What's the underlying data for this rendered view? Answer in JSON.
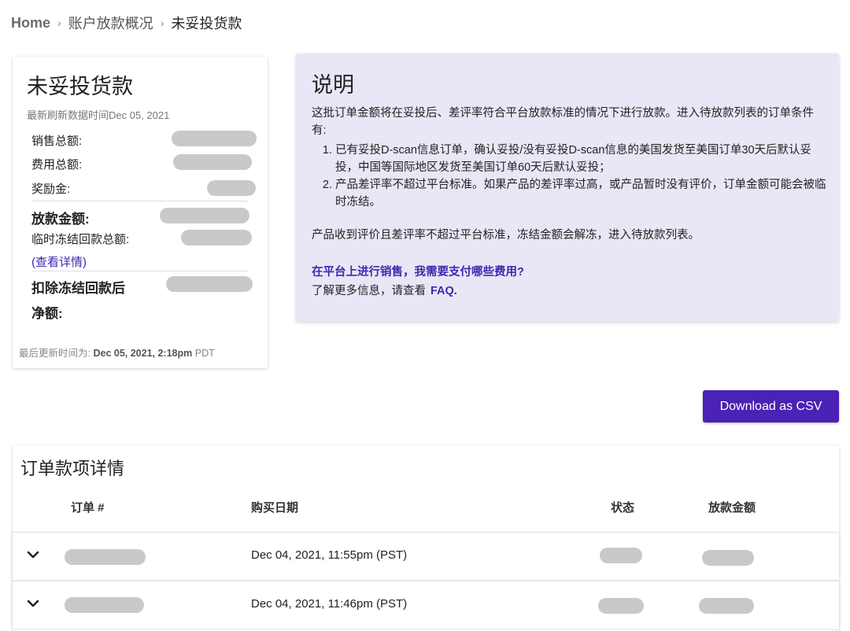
{
  "breadcrumb": {
    "home": "Home",
    "middle": "账户放款概况",
    "current": "未妥投货款",
    "separator": "›"
  },
  "summary": {
    "title": "未妥投货款",
    "refresh": "最新刷新数据时间Dec 05, 2021",
    "rows": {
      "sales": "销售总额:",
      "fees": "费用总额:",
      "bonus": "奖励金:",
      "payout": "放款金额:",
      "frozen": "临时冻结回款总额:",
      "details_link": "(查看详情)",
      "net_line1": "扣除冻结回款后",
      "net_line2": "净额:"
    },
    "footer": {
      "prefix": "最后更新时间为:",
      "time": "Dec 05, 2021, 2:18pm",
      "tz": "PDT"
    }
  },
  "info": {
    "title": "说明",
    "intro": "这批订单金额将在妥投后、差评率符合平台放款标准的情况下进行放款。进入待放款列表的订单条件有:",
    "items": [
      "已有妥投D-scan信息订单，确认妥投/没有妥投D-scan信息的美国发货至美国订单30天后默认妥投，中国等国际地区发货至美国订单60天后默认妥投；",
      "产品差评率不超过平台标准。如果产品的差评率过高，或产品暂时没有评价，订单金额可能会被临时冻结。"
    ],
    "note": "产品收到评价且差评率不超过平台标准，冻结金额会解冻，进入待放款列表。",
    "question": "在平台上进行销售，我需要支付哪些费用?",
    "more_prefix": "了解更多信息，请查看",
    "faq": "FAQ."
  },
  "download_button": "Download as CSV",
  "details": {
    "title": "订单款项详情",
    "columns": {
      "order": "订单 #",
      "date": "购买日期",
      "status": "状态",
      "amount": "放款金额"
    },
    "rows": [
      {
        "date": "Dec 04, 2021, 11:55pm (PST)"
      },
      {
        "date": "Dec 04, 2021, 11:46pm (PST)"
      }
    ]
  },
  "colors": {
    "accent": "#4a22b5",
    "link": "#3a2ab0",
    "info_bg": "#e9e6f6",
    "redacted": "#c9c9c9"
  }
}
